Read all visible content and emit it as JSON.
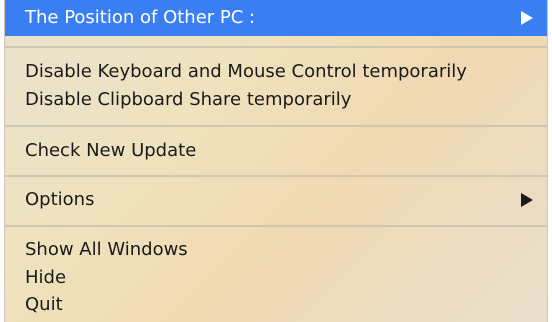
{
  "menu": {
    "items": [
      {
        "label": "The Position of Other PC :"
      },
      {
        "label": "Disable Keyboard and Mouse Control temporarily"
      },
      {
        "label": "Disable Clipboard Share temporarily"
      },
      {
        "label": "Check New Update"
      },
      {
        "label": "Options"
      },
      {
        "label": "Show All Windows"
      },
      {
        "label": "Hide"
      },
      {
        "label": "Quit"
      }
    ]
  },
  "colors": {
    "highlight": "#3a7ff2",
    "menu_background": "#efe2bd",
    "text": "#1a1a1a",
    "separator": "#cfc6b3"
  },
  "icons": {
    "submenu_indicator": "triangle-right-icon"
  }
}
